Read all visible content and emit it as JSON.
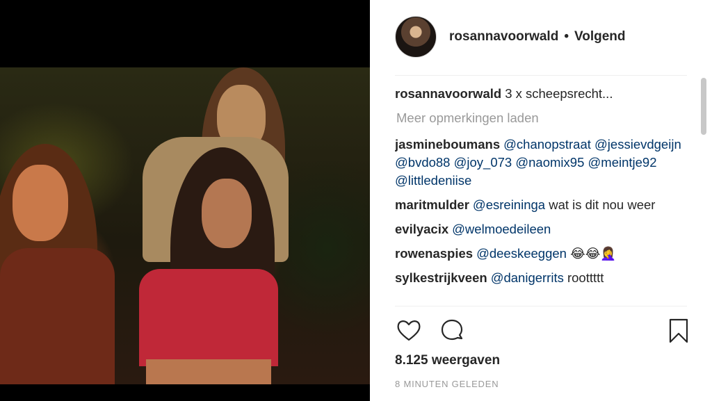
{
  "post": {
    "username": "rosannavoorwald",
    "separator": "•",
    "follow_label": "Volgend",
    "caption_user": "rosannavoorwald",
    "caption_text": "3 x scheepsrecht...",
    "load_more": "Meer opmerkingen laden",
    "views": "8.125 weergaven",
    "time": "8 MINUTEN GELEDEN"
  },
  "comments": [
    {
      "user": "jasmineboumans",
      "parts": [
        {
          "t": "@chanopstraat",
          "m": true
        },
        {
          "t": " ",
          "m": false
        },
        {
          "t": "@jessievdgeijn",
          "m": true
        },
        {
          "t": " ",
          "m": false
        },
        {
          "t": "@bvdo88",
          "m": true
        },
        {
          "t": " ",
          "m": false
        },
        {
          "t": "@joy_073",
          "m": true
        },
        {
          "t": " ",
          "m": false
        },
        {
          "t": "@naomix95",
          "m": true
        },
        {
          "t": " ",
          "m": false
        },
        {
          "t": "@meintje92",
          "m": true
        },
        {
          "t": " ",
          "m": false
        },
        {
          "t": "@littledeniise",
          "m": true
        }
      ]
    },
    {
      "user": "maritmulder",
      "parts": [
        {
          "t": "@esreininga",
          "m": true
        },
        {
          "t": " wat is dit nou weer",
          "m": false
        }
      ]
    },
    {
      "user": "evilyacix",
      "parts": [
        {
          "t": "@welmoedeileen",
          "m": true
        }
      ]
    },
    {
      "user": "rowenaspies",
      "parts": [
        {
          "t": "@deeskeeggen",
          "m": true
        },
        {
          "t": " 😂😂🤦‍♀️",
          "m": false
        }
      ]
    },
    {
      "user": "sylkestrijkveen",
      "parts": [
        {
          "t": "@danigerrits",
          "m": true
        },
        {
          "t": " roottttt",
          "m": false
        }
      ]
    }
  ],
  "icons": {
    "like": "heart-icon",
    "comment": "comment-bubble-icon",
    "save": "bookmark-icon"
  }
}
